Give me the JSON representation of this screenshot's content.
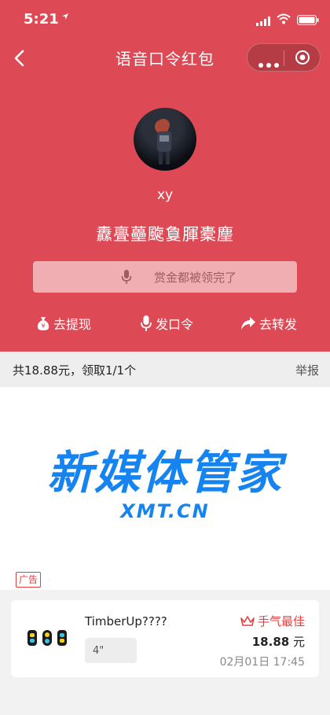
{
  "status": {
    "time": "5:21"
  },
  "nav": {
    "title": "语音口令红包"
  },
  "sender": {
    "name": "xy",
    "message": "纛亹蘲颴敻腪橐麈"
  },
  "voice_button": {
    "label": "赏金都被领完了"
  },
  "actions": [
    {
      "label": "去提现",
      "icon": "money-bag-icon"
    },
    {
      "label": "发口令",
      "icon": "microphone-icon"
    },
    {
      "label": "去转发",
      "icon": "share-arrow-icon"
    }
  ],
  "summary": {
    "text": "共18.88元，领取1/1个",
    "report": "举报"
  },
  "ad": {
    "headline": "新媒体管家",
    "domain": "XMT.CN",
    "tag": "广告"
  },
  "record": {
    "name": "TimberUp????",
    "voice_duration": "4\"",
    "best_label": "手气最佳",
    "amount": "18.88",
    "unit": "元",
    "time": "02月01日 17:45"
  },
  "colors": {
    "hero": "#dd4a55",
    "accent": "#e04040",
    "ad_blue": "#1684f0"
  }
}
